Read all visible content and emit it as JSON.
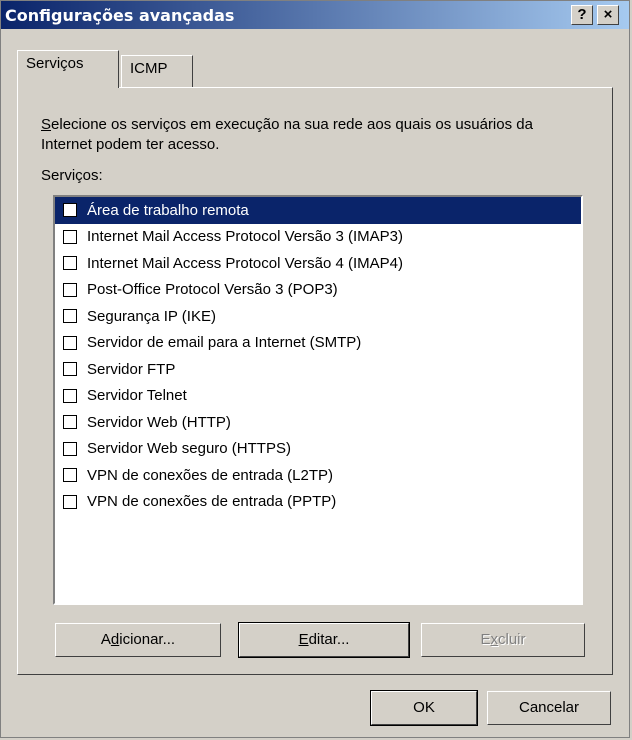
{
  "window": {
    "title": "Configurações avançadas",
    "help_glyph": "?",
    "close_glyph": "×"
  },
  "tabs": [
    {
      "label": "Serviços"
    },
    {
      "label": "ICMP"
    }
  ],
  "panel": {
    "description_access_key": "S",
    "description_rest": "elecione os serviços em execução na sua rede aos quais os usuários da Internet podem ter acesso.",
    "list_label": "Serviços:",
    "services": [
      {
        "label": "Área de trabalho remota",
        "checked": false,
        "selected": true
      },
      {
        "label": "Internet Mail Access Protocol Versão 3 (IMAP3)",
        "checked": false
      },
      {
        "label": "Internet Mail Access Protocol Versão 4 (IMAP4)",
        "checked": false
      },
      {
        "label": "Post-Office Protocol Versão 3 (POP3)",
        "checked": false
      },
      {
        "label": "Segurança IP (IKE)",
        "checked": false
      },
      {
        "label": "Servidor de email para a Internet (SMTP)",
        "checked": false
      },
      {
        "label": "Servidor FTP",
        "checked": false
      },
      {
        "label": "Servidor Telnet",
        "checked": false
      },
      {
        "label": "Servidor Web (HTTP)",
        "checked": false
      },
      {
        "label": "Servidor Web seguro (HTTPS)",
        "checked": false
      },
      {
        "label": "VPN de conexões de entrada (L2TP)",
        "checked": false
      },
      {
        "label": "VPN de conexões de entrada (PPTP)",
        "checked": false
      }
    ],
    "buttons": {
      "add": {
        "pre": "A",
        "key": "d",
        "post": "icionar..."
      },
      "edit": {
        "pre": "",
        "key": "E",
        "post": "ditar..."
      },
      "delete": {
        "pre": "E",
        "key": "x",
        "post": "cluir",
        "disabled": true
      }
    }
  },
  "footer": {
    "ok": "OK",
    "cancel": "Cancelar"
  },
  "colors": {
    "title_start": "#0a246a",
    "title_end": "#a6caf0",
    "selection": "#0a246a",
    "face": "#d4d0c8"
  }
}
